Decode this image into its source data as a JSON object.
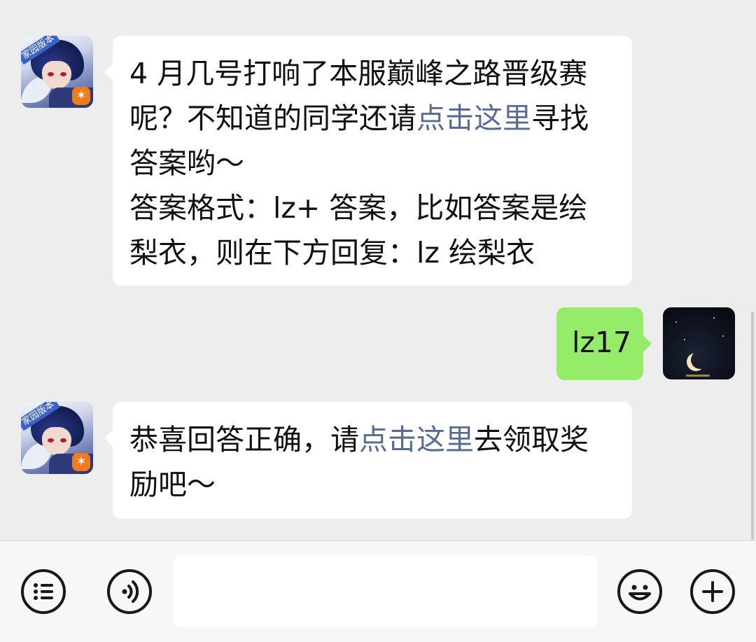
{
  "messages": [
    {
      "sender": "bot",
      "lines": [
        {
          "parts": [
            {
              "text": "4 月几号打响了本服巅峰之路晋级赛",
              "link": false
            }
          ]
        },
        {
          "parts": [
            {
              "text": "呢？不知道的同学还请",
              "link": false
            },
            {
              "text": "点击这里",
              "link": true
            },
            {
              "text": "寻找",
              "link": false
            }
          ]
        },
        {
          "parts": [
            {
              "text": "答案哟～",
              "link": false
            }
          ]
        },
        {
          "parts": [
            {
              "text": "答案格式：lz+ 答案，比如答案是绘",
              "link": false
            }
          ]
        },
        {
          "parts": [
            {
              "text": "梨衣，则在下方回复：lz 绘梨衣",
              "link": false
            }
          ]
        }
      ]
    },
    {
      "sender": "me",
      "text": "lz17"
    },
    {
      "sender": "bot",
      "lines": [
        {
          "parts": [
            {
              "text": "恭喜回答正确，请",
              "link": false
            },
            {
              "text": "点击这里",
              "link": true
            },
            {
              "text": "去领取奖",
              "link": false
            }
          ]
        },
        {
          "parts": [
            {
              "text": "励吧～",
              "link": false
            }
          ]
        }
      ]
    }
  ],
  "bot_avatar": {
    "tag": "家园版本",
    "logo": "✶"
  },
  "input_bar": {
    "menu_icon": "list-menu-icon",
    "voice_icon": "voice-icon",
    "emoji_icon": "emoji-icon",
    "plus_icon": "plus-icon",
    "input_placeholder": ""
  },
  "colors": {
    "chat_bg": "#ededed",
    "bot_bubble": "#ffffff",
    "my_bubble": "#95ec69",
    "link": "#576b95"
  }
}
